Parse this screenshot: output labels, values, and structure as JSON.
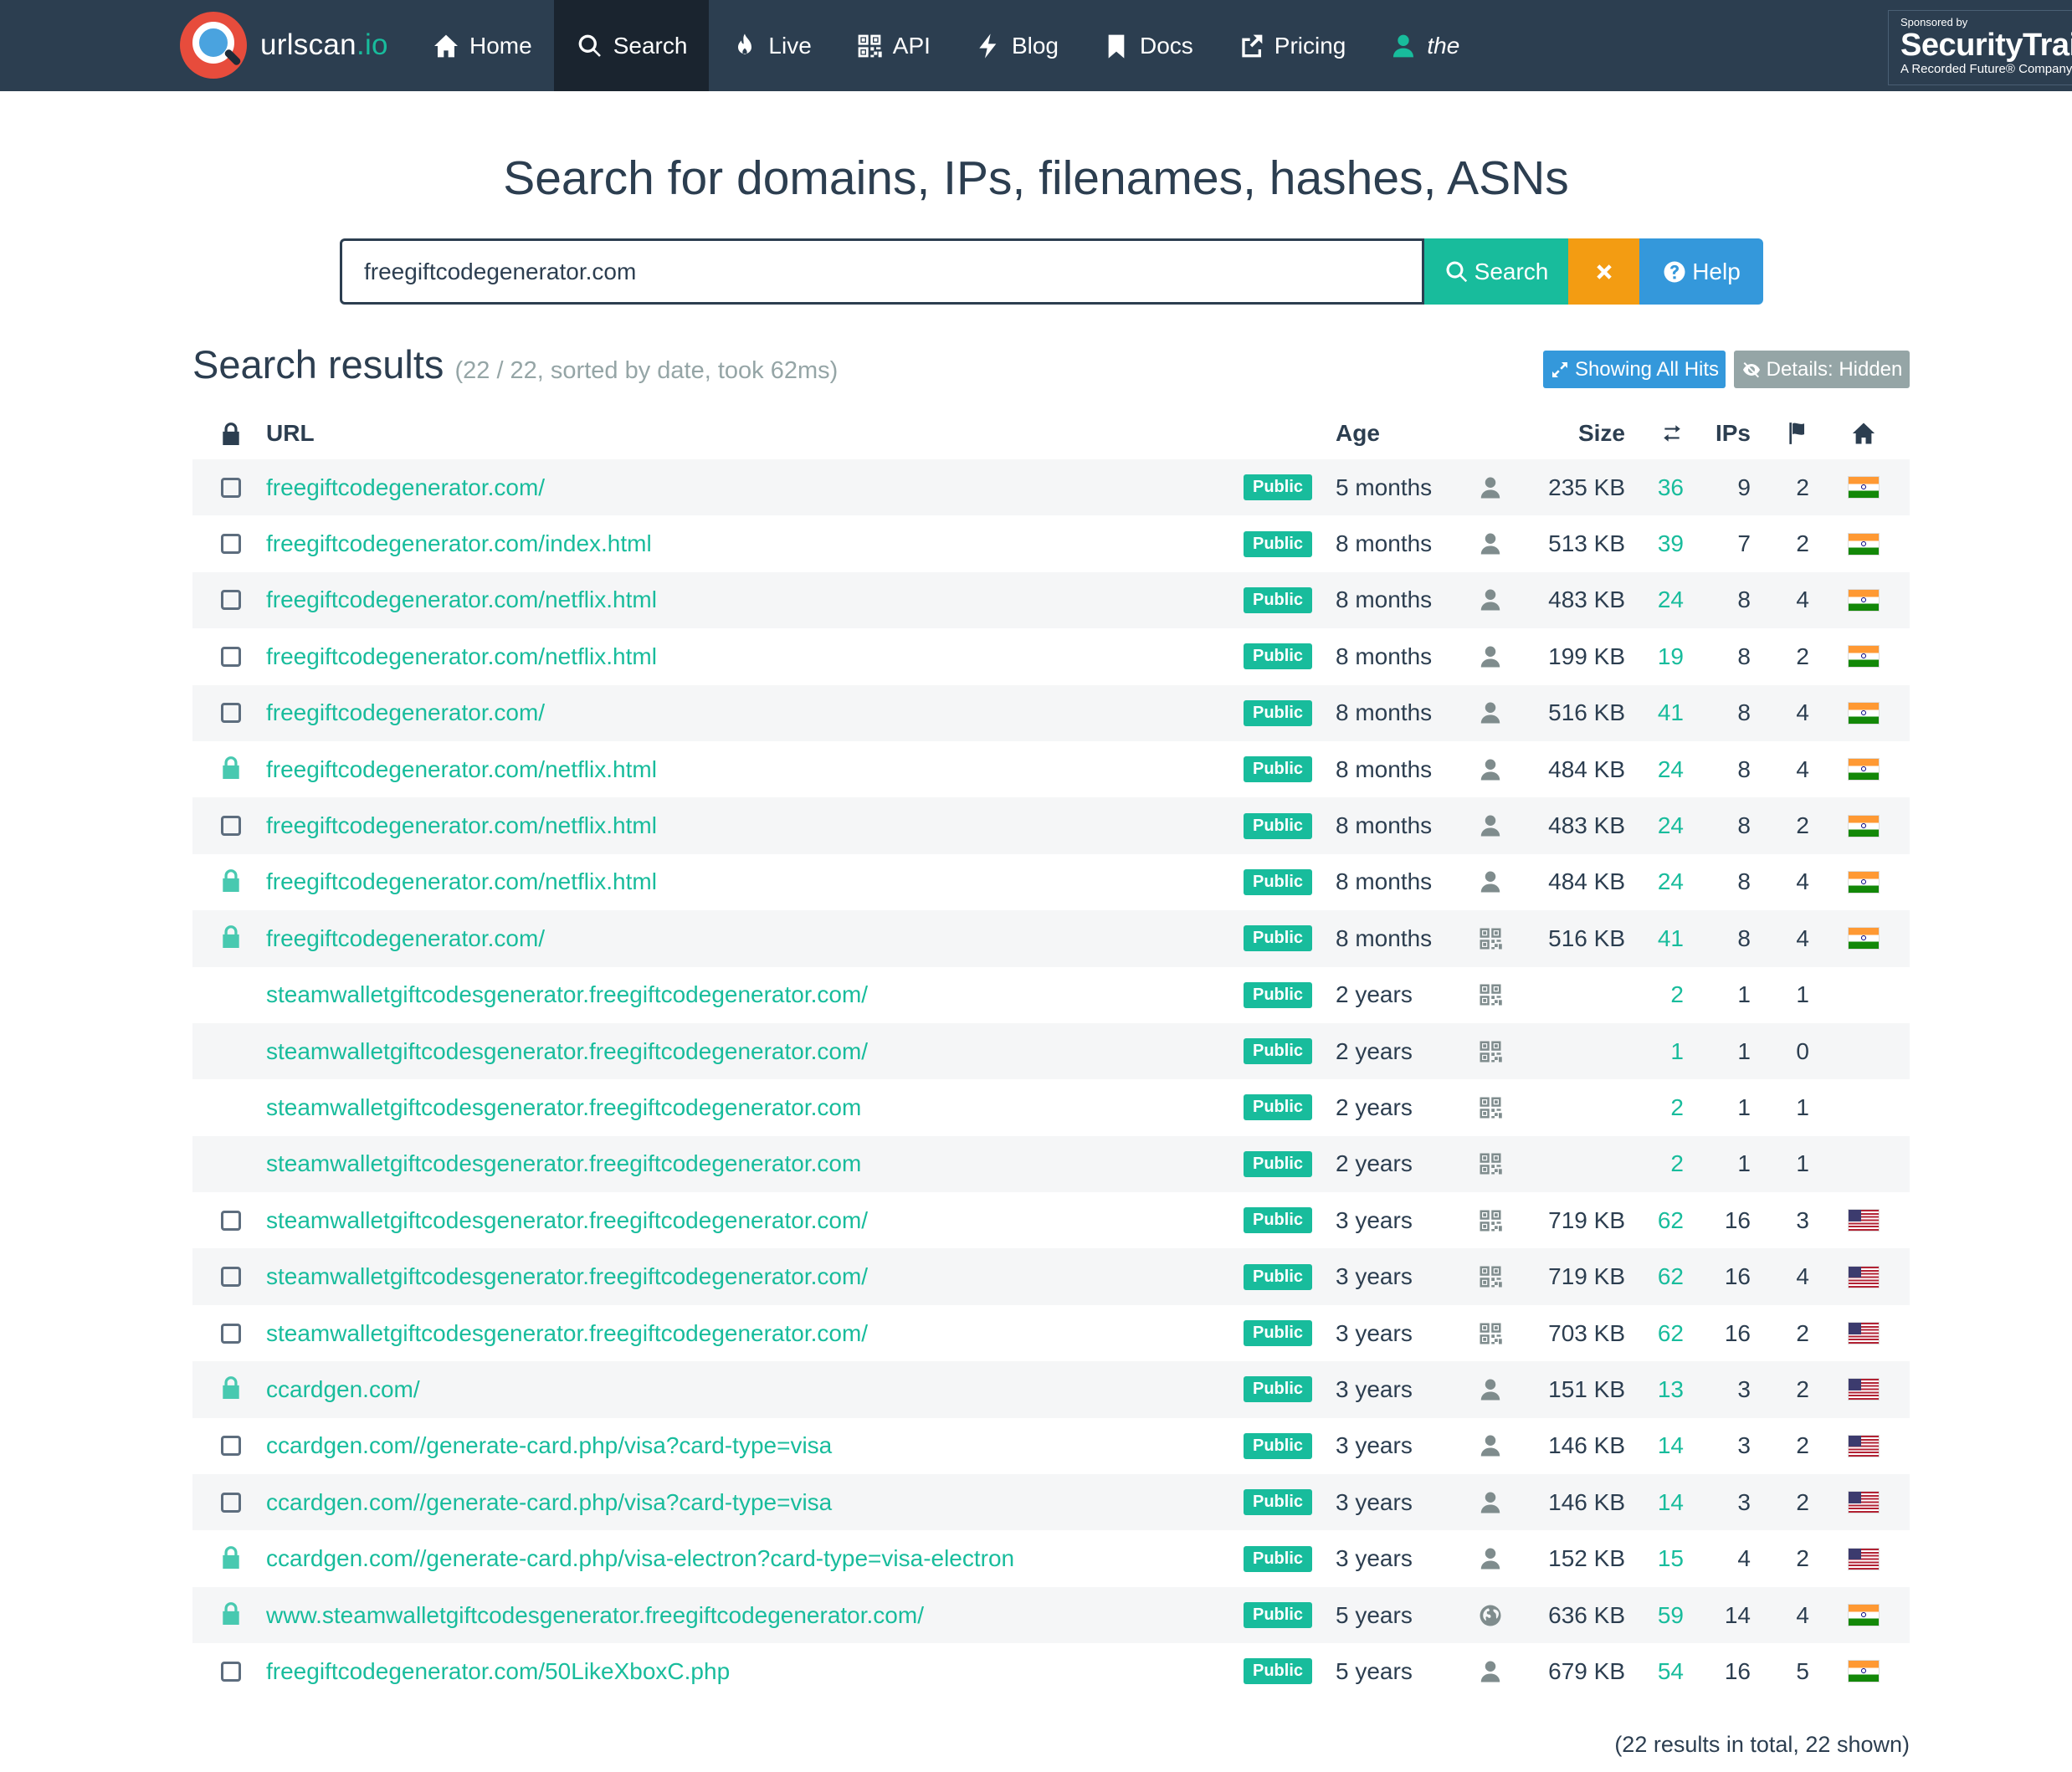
{
  "nav": {
    "brand_name": "urlscan",
    "brand_tld": ".io",
    "items": [
      {
        "label": "Home",
        "icon": "home-icon",
        "active": false
      },
      {
        "label": "Search",
        "icon": "search-icon",
        "active": true
      },
      {
        "label": "Live",
        "icon": "fire-icon",
        "active": false
      },
      {
        "label": "API",
        "icon": "qrcode-icon",
        "active": false
      },
      {
        "label": "Blog",
        "icon": "flash-icon",
        "active": false
      },
      {
        "label": "Docs",
        "icon": "bookmark-icon",
        "active": false
      },
      {
        "label": "Pricing",
        "icon": "external-link-icon",
        "active": false
      },
      {
        "label": "the",
        "icon": "user-icon",
        "active": false
      }
    ],
    "sponsor": {
      "line1": "Sponsored by",
      "line2": "SecurityTrails",
      "line3": "A Recorded Future® Company"
    }
  },
  "search": {
    "headline": "Search for domains, IPs, filenames, hashes, ASNs",
    "query": "freegiftcodegenerator.com",
    "search_label": "Search",
    "help_label": "Help"
  },
  "results": {
    "title": "Search results",
    "meta": "(22 / 22, sorted by date, took 62ms)",
    "showing_label": "Showing All Hits",
    "details_label": "Details: Hidden",
    "columns": {
      "url": "URL",
      "age": "Age",
      "size": "Size",
      "ips": "IPs"
    },
    "rows": [
      {
        "status": "checkbox",
        "url": "freegiftcodegenerator.com/",
        "badge": "Public",
        "age": "5 months",
        "source": "user-icon",
        "size": "235 KB",
        "requests": "36",
        "ips": "9",
        "countries": "2",
        "flag": "IN"
      },
      {
        "status": "checkbox",
        "url": "freegiftcodegenerator.com/index.html",
        "badge": "Public",
        "age": "8 months",
        "source": "user-icon",
        "size": "513 KB",
        "requests": "39",
        "ips": "7",
        "countries": "2",
        "flag": "IN"
      },
      {
        "status": "checkbox",
        "url": "freegiftcodegenerator.com/netflix.html",
        "badge": "Public",
        "age": "8 months",
        "source": "user-icon",
        "size": "483 KB",
        "requests": "24",
        "ips": "8",
        "countries": "4",
        "flag": "IN"
      },
      {
        "status": "checkbox",
        "url": "freegiftcodegenerator.com/netflix.html",
        "badge": "Public",
        "age": "8 months",
        "source": "user-icon",
        "size": "199 KB",
        "requests": "19",
        "ips": "8",
        "countries": "2",
        "flag": "IN"
      },
      {
        "status": "checkbox",
        "url": "freegiftcodegenerator.com/",
        "badge": "Public",
        "age": "8 months",
        "source": "user-icon",
        "size": "516 KB",
        "requests": "41",
        "ips": "8",
        "countries": "4",
        "flag": "IN"
      },
      {
        "status": "lock",
        "url": "freegiftcodegenerator.com/netflix.html",
        "badge": "Public",
        "age": "8 months",
        "source": "user-icon",
        "size": "484 KB",
        "requests": "24",
        "ips": "8",
        "countries": "4",
        "flag": "IN"
      },
      {
        "status": "checkbox",
        "url": "freegiftcodegenerator.com/netflix.html",
        "badge": "Public",
        "age": "8 months",
        "source": "user-icon",
        "size": "483 KB",
        "requests": "24",
        "ips": "8",
        "countries": "2",
        "flag": "IN"
      },
      {
        "status": "lock",
        "url": "freegiftcodegenerator.com/netflix.html",
        "badge": "Public",
        "age": "8 months",
        "source": "user-icon",
        "size": "484 KB",
        "requests": "24",
        "ips": "8",
        "countries": "4",
        "flag": "IN"
      },
      {
        "status": "lock",
        "url": "freegiftcodegenerator.com/",
        "badge": "Public",
        "age": "8 months",
        "source": "qrcode-icon",
        "size": "516 KB",
        "requests": "41",
        "ips": "8",
        "countries": "4",
        "flag": "IN"
      },
      {
        "status": "none",
        "url": "steamwalletgiftcodesgenerator.freegiftcodegenerator.com/",
        "badge": "Public",
        "age": "2 years",
        "source": "qrcode-icon",
        "size": "",
        "requests": "2",
        "ips": "1",
        "countries": "1",
        "flag": ""
      },
      {
        "status": "none",
        "url": "steamwalletgiftcodesgenerator.freegiftcodegenerator.com/",
        "badge": "Public",
        "age": "2 years",
        "source": "qrcode-icon",
        "size": "",
        "requests": "1",
        "ips": "1",
        "countries": "0",
        "flag": ""
      },
      {
        "status": "none",
        "url": "steamwalletgiftcodesgenerator.freegiftcodegenerator.com",
        "badge": "Public",
        "age": "2 years",
        "source": "qrcode-icon",
        "size": "",
        "requests": "2",
        "ips": "1",
        "countries": "1",
        "flag": ""
      },
      {
        "status": "none",
        "url": "steamwalletgiftcodesgenerator.freegiftcodegenerator.com",
        "badge": "Public",
        "age": "2 years",
        "source": "qrcode-icon",
        "size": "",
        "requests": "2",
        "ips": "1",
        "countries": "1",
        "flag": ""
      },
      {
        "status": "checkbox",
        "url": "steamwalletgiftcodesgenerator.freegiftcodegenerator.com/",
        "badge": "Public",
        "age": "3 years",
        "source": "qrcode-icon",
        "size": "719 KB",
        "requests": "62",
        "ips": "16",
        "countries": "3",
        "flag": "US"
      },
      {
        "status": "checkbox",
        "url": "steamwalletgiftcodesgenerator.freegiftcodegenerator.com/",
        "badge": "Public",
        "age": "3 years",
        "source": "qrcode-icon",
        "size": "719 KB",
        "requests": "62",
        "ips": "16",
        "countries": "4",
        "flag": "US"
      },
      {
        "status": "checkbox",
        "url": "steamwalletgiftcodesgenerator.freegiftcodegenerator.com/",
        "badge": "Public",
        "age": "3 years",
        "source": "qrcode-icon",
        "size": "703 KB",
        "requests": "62",
        "ips": "16",
        "countries": "2",
        "flag": "US"
      },
      {
        "status": "lock",
        "url": "ccardgen.com/",
        "badge": "Public",
        "age": "3 years",
        "source": "user-icon",
        "size": "151 KB",
        "requests": "13",
        "ips": "3",
        "countries": "2",
        "flag": "US"
      },
      {
        "status": "checkbox",
        "url": "ccardgen.com//generate-card.php/visa?card-type=visa",
        "badge": "Public",
        "age": "3 years",
        "source": "user-icon",
        "size": "146 KB",
        "requests": "14",
        "ips": "3",
        "countries": "2",
        "flag": "US"
      },
      {
        "status": "checkbox",
        "url": "ccardgen.com//generate-card.php/visa?card-type=visa",
        "badge": "Public",
        "age": "3 years",
        "source": "user-icon",
        "size": "146 KB",
        "requests": "14",
        "ips": "3",
        "countries": "2",
        "flag": "US"
      },
      {
        "status": "lock",
        "url": "ccardgen.com//generate-card.php/visa-electron?card-type=visa-electron",
        "badge": "Public",
        "age": "3 years",
        "source": "user-icon",
        "size": "152 KB",
        "requests": "15",
        "ips": "4",
        "countries": "2",
        "flag": "US"
      },
      {
        "status": "lock",
        "url": "www.steamwalletgiftcodesgenerator.freegiftcodegenerator.com/",
        "badge": "Public",
        "age": "5 years",
        "source": "globe-icon",
        "size": "636 KB",
        "requests": "59",
        "ips": "14",
        "countries": "4",
        "flag": "IN"
      },
      {
        "status": "checkbox",
        "url": "freegiftcodegenerator.com/50LikeXboxC.php",
        "badge": "Public",
        "age": "5 years",
        "source": "user-icon",
        "size": "679 KB",
        "requests": "54",
        "ips": "16",
        "countries": "5",
        "flag": "IN"
      }
    ],
    "footer": "(22 results in total, 22 shown)"
  },
  "colors": {
    "navbar": "#2c3e50",
    "accent": "#18bc9c",
    "warning": "#f39c12",
    "info": "#3498db",
    "muted": "#95a5a6"
  }
}
